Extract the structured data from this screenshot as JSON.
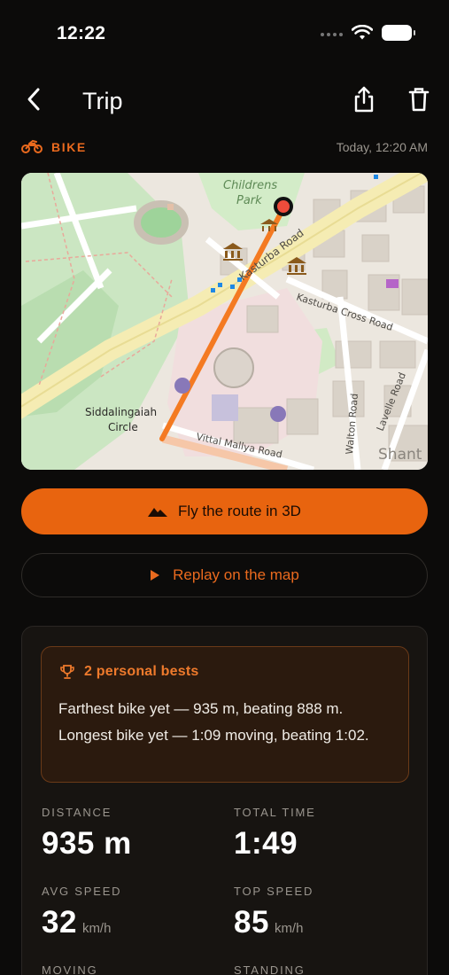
{
  "status_bar": {
    "time": "12:22"
  },
  "nav": {
    "title": "Trip"
  },
  "trip": {
    "activity": "BIKE",
    "date": "Today, 12:20 AM"
  },
  "map": {
    "labels": {
      "park": [
        "Childrens",
        "Park"
      ],
      "kasturba_road": "Kasturba Road",
      "kasturba_cross": "Kasturba Cross Road",
      "siddalingaiah": [
        "Siddalingaiah",
        "Circle"
      ],
      "vittal": "Vittal Mallya Road",
      "walton": "Walton Road",
      "lavelle": "Lavelle Road",
      "shanti": "Shant"
    }
  },
  "actions": {
    "fly_label": "Fly the route in 3D",
    "replay_label": "Replay on the map"
  },
  "personal_bests": {
    "title": "2 personal bests",
    "lines": [
      "Farthest bike yet — 935 m, beating 888 m.",
      "Longest bike yet — 1:09 moving, beating 1:02."
    ]
  },
  "stats": {
    "distance": {
      "label": "DISTANCE",
      "value": "935 m",
      "unit": ""
    },
    "total_time": {
      "label": "TOTAL TIME",
      "value": "1:49",
      "unit": ""
    },
    "avg_speed": {
      "label": "AVG SPEED",
      "value": "32",
      "unit": "km/h"
    },
    "top_speed": {
      "label": "TOP SPEED",
      "value": "85",
      "unit": "km/h"
    },
    "moving": {
      "label": "MOVING"
    },
    "standing": {
      "label": "STANDING"
    }
  },
  "colors": {
    "accent": "#e8640f",
    "route": "#f47a22",
    "background": "#0c0b0a"
  }
}
